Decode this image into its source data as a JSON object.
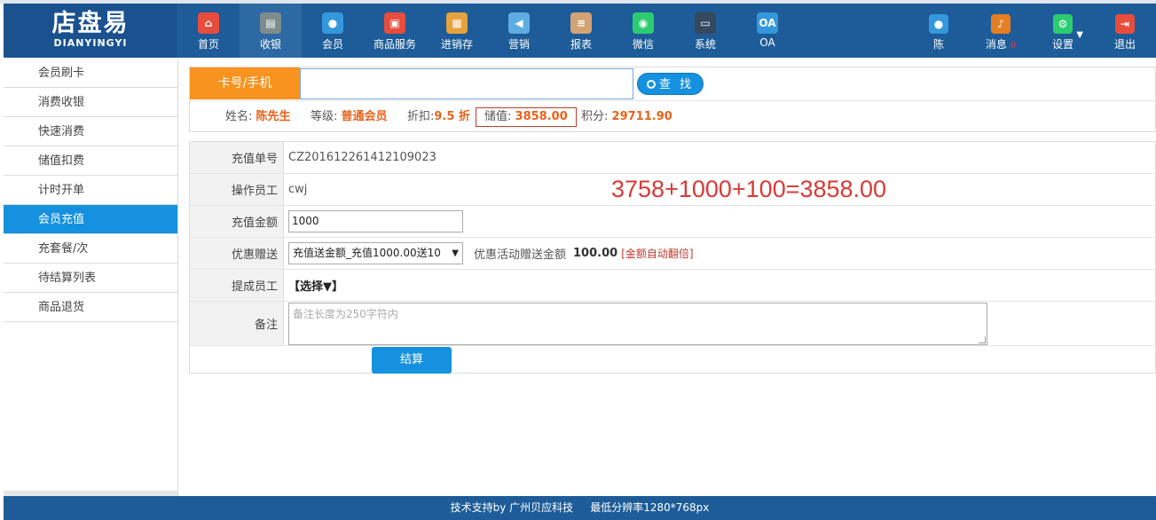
{
  "logo": {
    "cn": "店盘易",
    "en": "DIANYINGYI"
  },
  "nav": [
    {
      "label": "首页",
      "icon": "home-icon",
      "color": "#e74c3c",
      "glyph": "⌂"
    },
    {
      "label": "收银",
      "icon": "cash-register-icon",
      "color": "#7f8c8d",
      "glyph": "▤"
    },
    {
      "label": "会员",
      "icon": "member-icon",
      "color": "#3498db",
      "glyph": "●"
    },
    {
      "label": "商品服务",
      "icon": "goods-icon",
      "color": "#e74c3c",
      "glyph": "▣"
    },
    {
      "label": "进销存",
      "icon": "inventory-icon",
      "color": "#e6a23c",
      "glyph": "▦"
    },
    {
      "label": "营销",
      "icon": "marketing-icon",
      "color": "#5dade2",
      "glyph": "◀"
    },
    {
      "label": "报表",
      "icon": "report-icon",
      "color": "#d4a373",
      "glyph": "≡"
    },
    {
      "label": "微信",
      "icon": "wechat-icon",
      "color": "#2ecc71",
      "glyph": "◉"
    },
    {
      "label": "系统",
      "icon": "system-icon",
      "color": "#34495e",
      "glyph": "▭"
    },
    {
      "label": "OA",
      "icon": "oa-icon",
      "color": "#3498db",
      "glyph": "OA"
    }
  ],
  "right_nav": [
    {
      "label": "陈",
      "icon": "user-icon",
      "color": "#3498db",
      "glyph": "●"
    },
    {
      "label": "消息",
      "badge": "0",
      "icon": "bell-icon",
      "color": "#e67e22",
      "glyph": "♪"
    },
    {
      "label": "设置",
      "icon": "settings-icon",
      "color": "#2ecc71",
      "glyph": "⚙",
      "caret": "▼"
    },
    {
      "label": "退出",
      "icon": "logout-icon",
      "color": "#e74c3c",
      "glyph": "⇥"
    }
  ],
  "sidebar": {
    "items": [
      {
        "label": "会员刷卡"
      },
      {
        "label": "消费收银"
      },
      {
        "label": "快速消费"
      },
      {
        "label": "储值扣费"
      },
      {
        "label": "计时开单"
      },
      {
        "label": "会员充值",
        "active": true
      },
      {
        "label": "充套餐/次"
      },
      {
        "label": "待结算列表"
      },
      {
        "label": "商品退货"
      }
    ]
  },
  "search": {
    "label": "卡号/手机",
    "value": "",
    "button": "查 找"
  },
  "member": {
    "name_label": "姓名:",
    "name": "陈先生",
    "level_label": "等级:",
    "level": "普通会员",
    "discount_label": "折扣:",
    "discount": "9.5 折",
    "balance_label": "储值:",
    "balance": "3858.00",
    "points_label": "积分:",
    "points": "29711.90"
  },
  "form": {
    "order_no_label": "充值单号",
    "order_no": "CZ201612261412109023",
    "operator_label": "操作员工",
    "operator": "cwj",
    "amount_label": "充值金额",
    "amount": "1000",
    "promo_label": "优惠赠送",
    "promo_selected": "充值送金额_充值1000.00送10",
    "promo_bonus_label": "优惠活动赠送金额",
    "promo_bonus": "100.00",
    "promo_note": "[金额自动翻倍]",
    "commission_label": "提成员工",
    "commission_select": "【选择▼】",
    "remark_label": "备注",
    "remark_placeholder": "备注长度为250字符内",
    "submit": "结算"
  },
  "annotation": "3758+1000+100=3858.00",
  "footer": "技术支持by 广州贝应科技     最低分辨率1280*768px"
}
